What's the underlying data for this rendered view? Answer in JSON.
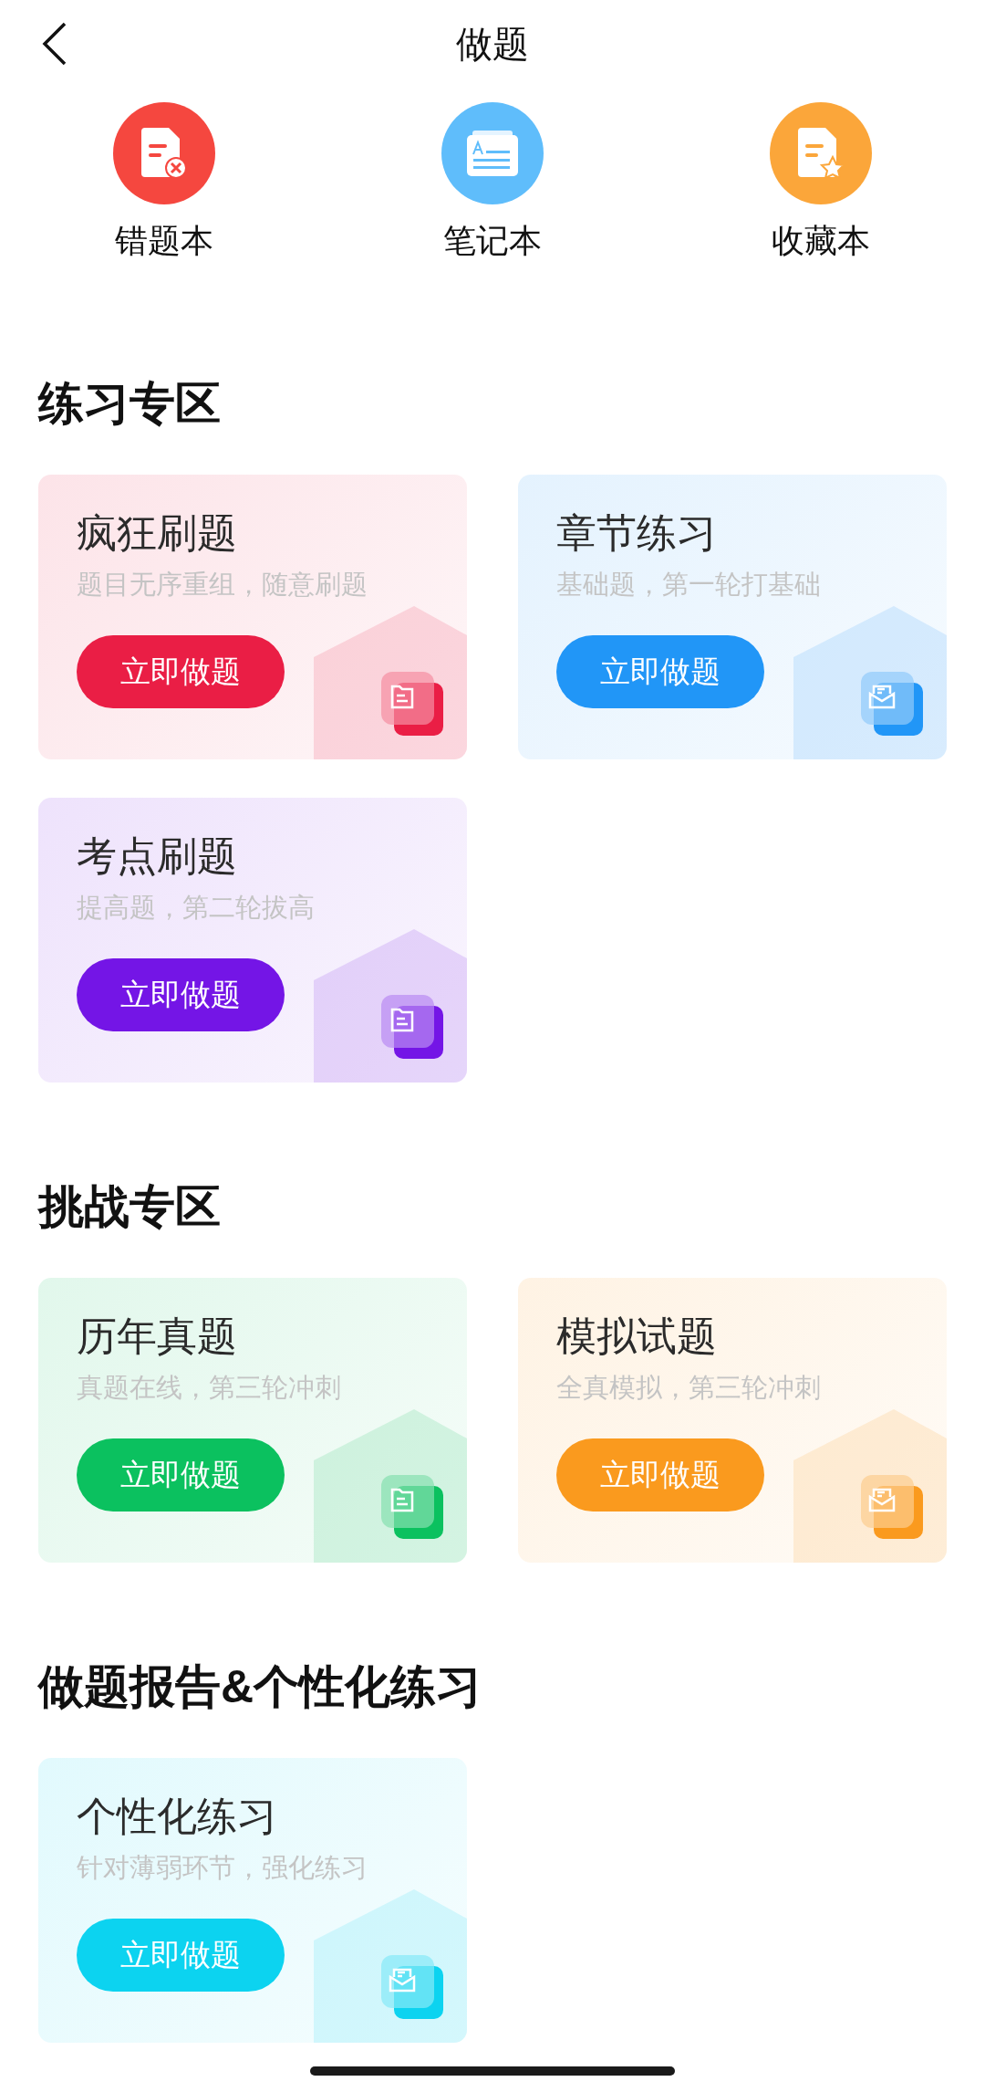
{
  "header": {
    "title": "做题"
  },
  "shortcuts": [
    {
      "label": "错题本",
      "color": "#f5473f",
      "kind": "wrong"
    },
    {
      "label": "笔记本",
      "color": "#5fbdfb",
      "kind": "note"
    },
    {
      "label": "收藏本",
      "color": "#fba63a",
      "kind": "star"
    }
  ],
  "sections": [
    {
      "title": "练习专区",
      "cards": [
        {
          "title": "疯狂刷题",
          "subtitle": "题目无序重组，随意刷题",
          "button": "立即做题",
          "color": "#ea1e45",
          "kind": "doc"
        },
        {
          "title": "章节练习",
          "subtitle": "基础题，第一轮打基础",
          "button": "立即做题",
          "color": "#2196f7",
          "kind": "mail"
        },
        {
          "title": "考点刷题",
          "subtitle": "提高题，第二轮拔高",
          "button": "立即做题",
          "color": "#7415e6",
          "kind": "doc"
        }
      ]
    },
    {
      "title": "挑战专区",
      "cards": [
        {
          "title": "历年真题",
          "subtitle": "真题在线，第三轮冲刺",
          "button": "立即做题",
          "color": "#0bc15f",
          "kind": "doc"
        },
        {
          "title": "模拟试题",
          "subtitle": "全真模拟，第三轮冲刺",
          "button": "立即做题",
          "color": "#fa9a1e",
          "kind": "mail"
        }
      ]
    },
    {
      "title": "做题报告&个性化练习",
      "cards": [
        {
          "title": "个性化练习",
          "subtitle": "针对薄弱环节，强化练习",
          "button": "立即做题",
          "color": "#0cd3f0",
          "kind": "mail"
        }
      ]
    }
  ]
}
